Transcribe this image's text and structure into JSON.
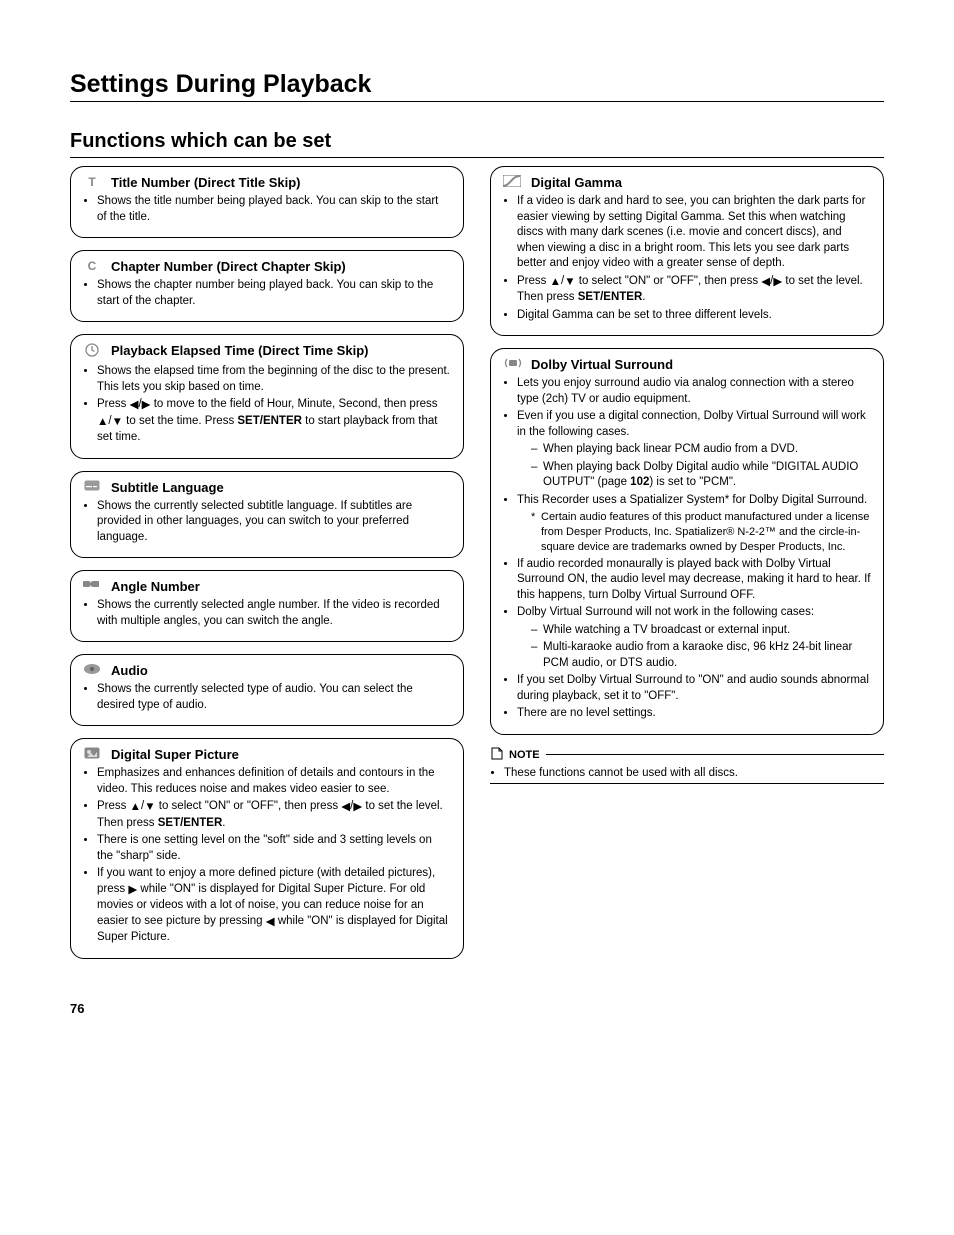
{
  "page_number": "76",
  "page_title": "Settings During Playback",
  "section_title": "Functions which can be set",
  "left": {
    "title_skip": {
      "title": "Title Number (Direct Title Skip)",
      "b1": "Shows the title number being played back. You can skip to the start of the title."
    },
    "chapter_skip": {
      "title": "Chapter Number (Direct Chapter Skip)",
      "b1": "Shows the chapter number being played back. You can skip to the start of the chapter."
    },
    "time_skip": {
      "title": "Playback Elapsed Time (Direct Time Skip)",
      "b1a": "Shows the elapsed time from the beginning of the disc to the present.",
      "b1b": "This lets you skip based on time.",
      "b2_prefix1": "Press ",
      "b2_mid1": " to move to the field of Hour, Minute, Second, then press ",
      "b2_mid2": " to set the time. Press ",
      "b2_set_enter": "SET/ENTER",
      "b2_suffix": " to start playback from that set time."
    },
    "subtitle": {
      "title": "Subtitle Language",
      "b1": "Shows the currently selected subtitle language. If subtitles are provided in other languages, you can switch to your preferred language."
    },
    "angle": {
      "title": "Angle Number",
      "b1": "Shows the currently selected angle number. If the video is recorded with multiple angles, you can switch the angle."
    },
    "audio": {
      "title": "Audio",
      "b1": "Shows the currently selected type of audio. You can select the desired type of audio."
    },
    "dsp": {
      "title": "Digital Super Picture",
      "b1": "Emphasizes and enhances definition of details and contours in the video. This reduces noise and makes video easier to see.",
      "b2_prefix": "Press ",
      "b2_mid1": " to select \"ON\" or \"OFF\", then press ",
      "b2_mid2": " to set the level. Then press ",
      "b2_set_enter": "SET/ENTER",
      "b2_suffix": ".",
      "b3": "There is one setting level on the \"soft\" side and 3 setting levels on the \"sharp\" side.",
      "b4_prefix": "If you want to enjoy a more defined picture (with detailed pictures), press ",
      "b4_mid1": " while \"ON\" is displayed for Digital Super Picture. For old movies or videos with a lot of noise, you can reduce noise for an easier to see picture by pressing ",
      "b4_suffix": " while \"ON\" is displayed for Digital Super Picture."
    }
  },
  "right": {
    "gamma": {
      "title": "Digital Gamma",
      "b1": "If a video is dark and hard to see, you can brighten the dark parts for easier viewing by setting Digital Gamma. Set this when watching discs with many dark scenes (i.e. movie and concert discs), and when viewing a disc in a bright room. This lets you see dark parts better and enjoy video with a greater sense of depth.",
      "b2_prefix": "Press ",
      "b2_mid1": " to select \"ON\" or \"OFF\", then press ",
      "b2_mid2": " to set the level. Then press ",
      "b2_set_enter": "SET/ENTER",
      "b2_suffix": ".",
      "b3": "Digital Gamma can be set to three different levels."
    },
    "dolby": {
      "title": "Dolby Virtual Surround",
      "b1": "Lets you enjoy surround audio via analog connection with a stereo type (2ch) TV or audio equipment.",
      "b2": "Even if you use a digital connection, Dolby Virtual Surround will work in the following cases.",
      "b2_d1": "When playing back linear PCM audio from a DVD.",
      "b2_d2_prefix": "When playing back Dolby Digital audio while \"DIGITAL AUDIO OUTPUT\" (page ",
      "b2_d2_page": "102",
      "b2_d2_suffix": ") is set to \"PCM\".",
      "b3": "This Recorder uses a Spatializer System* for Dolby Digital Surround.",
      "b3_star": "Certain audio features of this product manufactured under a license from Desper Products, Inc. Spatializer® N-2-2™ and the circle-in-square device are trademarks owned by Desper Products, Inc.",
      "b4": "If audio recorded monaurally is played back with Dolby Virtual Surround ON, the audio level may decrease, making it hard to hear. If this happens, turn Dolby Virtual Surround OFF.",
      "b5": "Dolby Virtual Surround will not work in the following cases:",
      "b5_d1": "While watching a TV broadcast or external input.",
      "b5_d2": "Multi-karaoke audio from a karaoke disc, 96 kHz 24-bit linear PCM audio, or DTS audio.",
      "b6": "If you set Dolby Virtual Surround to \"ON\" and audio sounds abnormal during playback, set it to \"OFF\".",
      "b7": "There are no level settings."
    },
    "note": {
      "label": "NOTE",
      "text": "These functions cannot be used with all discs."
    }
  }
}
